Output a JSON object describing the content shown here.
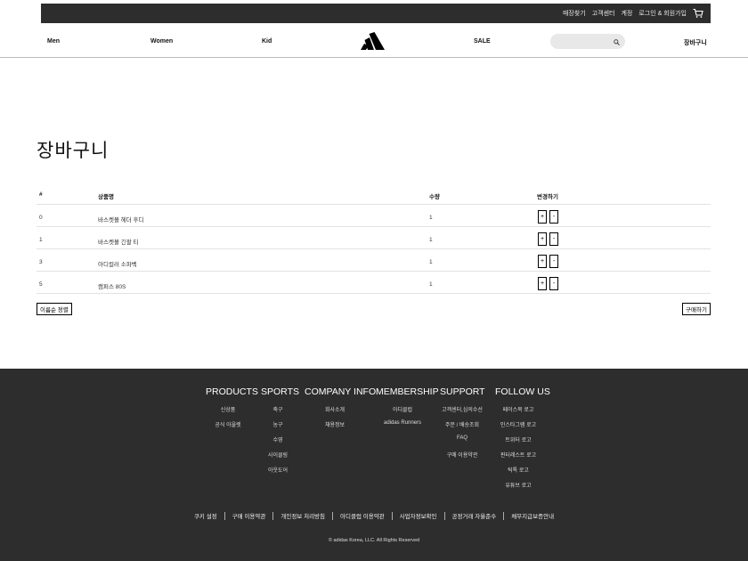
{
  "topbar": {
    "links": [
      "매장찾기",
      "고객센터",
      "계정",
      "로그인 & 회원가입"
    ],
    "cart_icon": "cart-icon"
  },
  "nav": {
    "men": "Men",
    "women": "Women",
    "kid": "Kid",
    "logo_icon": "adidas-logo",
    "sale": "SALE",
    "search_placeholder": "",
    "search_icon": "search-icon",
    "cart": "장바구니"
  },
  "cart": {
    "title": "장바구니",
    "columns": [
      "#",
      "상품명",
      "수량",
      "변경하기"
    ],
    "rows": [
      {
        "idx": "0",
        "name": "바스켓볼 헤더 후디",
        "qty": "1"
      },
      {
        "idx": "1",
        "name": "바스켓볼 긴팔 티",
        "qty": "1"
      },
      {
        "idx": "3",
        "name": "아디컬러 소파벡",
        "qty": "1"
      },
      {
        "idx": "5",
        "name": "캠퍼스 80S",
        "qty": "1"
      }
    ],
    "plus": "+",
    "minus": "-",
    "sort_label": "이름순 정렬",
    "buy_label": "구매하기"
  },
  "footer": {
    "columns": [
      {
        "head": "PRODUCTS",
        "links": [
          "신상품",
          "공식 아울렛"
        ]
      },
      {
        "head": "SPORTS",
        "links": [
          "축구",
          "농구",
          "수영",
          "사이클링",
          "아웃도어"
        ]
      },
      {
        "head": "COMPANY INFO",
        "links": [
          "회사소개",
          "채용정보"
        ]
      },
      {
        "head": "MEMBERSHIP",
        "links": [
          "아디클럽",
          "adidas Runners"
        ]
      },
      {
        "head": "SUPPORT",
        "links": [
          "고객센터,심의수선",
          "주문 / 배송조회",
          "FAQ",
          "구매 이용약관"
        ]
      },
      {
        "head": "FOLLOW US",
        "links": [
          "페이스북 로고",
          "인스타그램 로고",
          "트위터 로고",
          "핀터레스트 로고",
          "틱톡 로고",
          "유튜브 로고"
        ]
      }
    ],
    "legal": [
      "쿠키 설정",
      "구매 이용약관",
      "개인정보 처리방침",
      "아디클럽 이용약관",
      "사업자정보확인",
      "공정거래 자율준수",
      "채무지급보증안내"
    ],
    "copyright": "© adidas Korea, LLC. All Rights Reserved"
  }
}
